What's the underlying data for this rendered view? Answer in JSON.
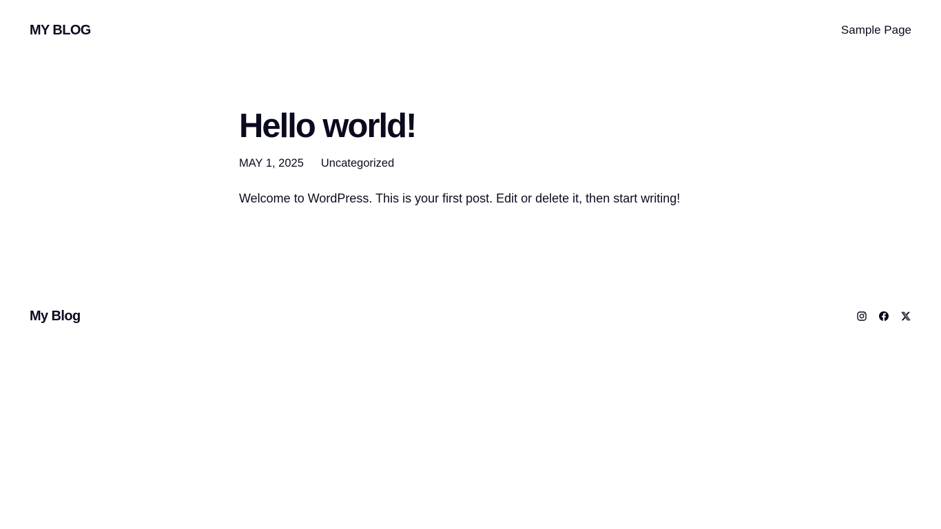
{
  "header": {
    "site_title": "MY BLOG",
    "nav": [
      {
        "label": "Sample Page"
      }
    ]
  },
  "post": {
    "title": "Hello world!",
    "date": "MAY 1, 2025",
    "category": "Uncategorized",
    "content": "Welcome to WordPress. This is your first post. Edit or delete it, then start writing!"
  },
  "footer": {
    "site_title": "My Blog",
    "social_links": [
      {
        "icon": "instagram-icon"
      },
      {
        "icon": "facebook-icon"
      },
      {
        "icon": "x-twitter-icon"
      }
    ]
  },
  "colors": {
    "background": "#ffffff",
    "text": "#0b0b1f"
  }
}
